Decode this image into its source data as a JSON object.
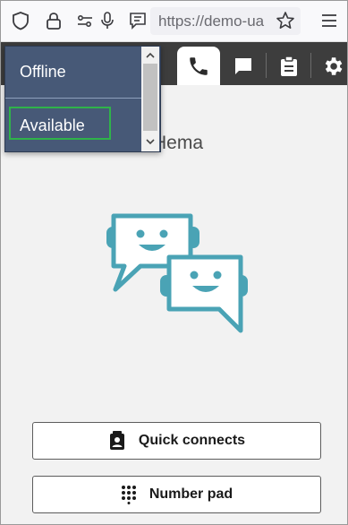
{
  "browser": {
    "url": "https://demo-ua"
  },
  "app": {
    "welcome_text": "me Hema"
  },
  "status_dropdown": {
    "options": [
      "Offline",
      "Available"
    ],
    "focused_option": "Available"
  },
  "buttons": {
    "quick_connects": "Quick connects",
    "number_pad": "Number pad"
  },
  "colors": {
    "header_bg": "#3d3d3d",
    "dropdown_bg": "#475977",
    "focus_ring": "#2fb34a",
    "illustration_teal": "#4aa3b5"
  }
}
